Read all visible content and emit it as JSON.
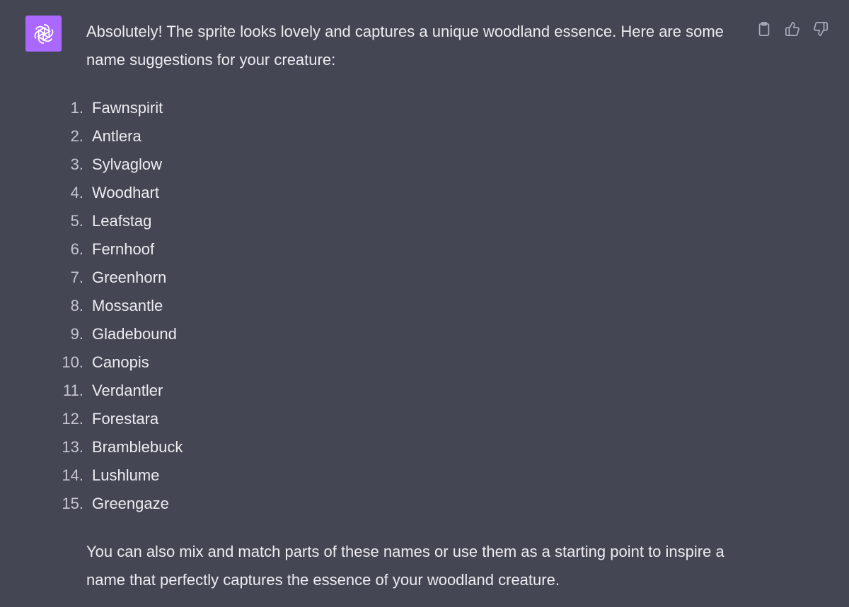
{
  "assistant": {
    "avatar_icon": "openai-logo-icon",
    "avatar_color": "#AB68FF"
  },
  "message": {
    "intro": "Absolutely! The sprite looks lovely and captures a unique woodland essence. Here are some name suggestions for your creature:",
    "names": [
      {
        "num": "1.",
        "name": "Fawnspirit"
      },
      {
        "num": "2.",
        "name": "Antlera"
      },
      {
        "num": "3.",
        "name": "Sylvaglow"
      },
      {
        "num": "4.",
        "name": "Woodhart"
      },
      {
        "num": "5.",
        "name": "Leafstag"
      },
      {
        "num": "6.",
        "name": "Fernhoof"
      },
      {
        "num": "7.",
        "name": "Greenhorn"
      },
      {
        "num": "8.",
        "name": "Mossantle"
      },
      {
        "num": "9.",
        "name": "Gladebound"
      },
      {
        "num": "10.",
        "name": "Canopis"
      },
      {
        "num": "11.",
        "name": "Verdantler"
      },
      {
        "num": "12.",
        "name": "Forestara"
      },
      {
        "num": "13.",
        "name": "Bramblebuck"
      },
      {
        "num": "14.",
        "name": "Lushlume"
      },
      {
        "num": "15.",
        "name": "Greengaze"
      }
    ],
    "outro": "You can also mix and match parts of these names or use them as a starting point to inspire a name that perfectly captures the essence of your woodland creature."
  },
  "actions": [
    {
      "icon": "clipboard-icon"
    },
    {
      "icon": "thumbs-up-icon"
    },
    {
      "icon": "thumbs-down-icon"
    }
  ],
  "colors": {
    "background": "#444654",
    "text": "#ECECF1",
    "list_number": "#C5C5D2",
    "icon": "#ACACBE"
  }
}
